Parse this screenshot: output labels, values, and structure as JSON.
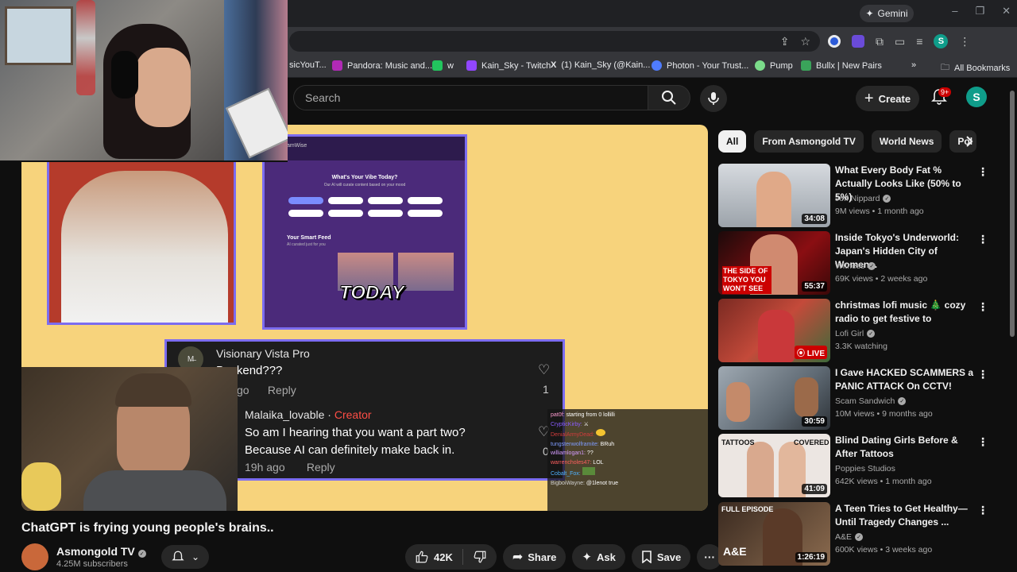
{
  "browser": {
    "gemini_label": "Gemini",
    "window_controls": [
      "–",
      "❐",
      "✕"
    ],
    "profile_letter": "S",
    "bookmarks": [
      {
        "label": "sicYouT...",
        "color": "#cc0000"
      },
      {
        "label": "Pandora: Music and...",
        "color": "#b02ab5"
      },
      {
        "label": "w",
        "color": "#22c55e"
      },
      {
        "label": "Kain_Sky - Twitch",
        "color": "#9146ff"
      },
      {
        "label": "(1) Kain_Sky (@Kain...",
        "color": "#000000"
      },
      {
        "label": "Photon - Your Trust...",
        "color": "#4f7cff"
      },
      {
        "label": "Pump",
        "color": "#7bdc8a"
      },
      {
        "label": "Bullx | New Pairs",
        "color": "#3aa35a"
      }
    ],
    "all_bookmarks": "All Bookmarks",
    "more_bookmarks": "»"
  },
  "header": {
    "search_placeholder": "Search",
    "create_label": "Create",
    "notif_badge": "9+",
    "avatar_letter": "S"
  },
  "video": {
    "overlay_text": "TODAY",
    "app_header": "amWise",
    "app_heading": "What's Your Vibe Today?",
    "app_sub": "Our AI will curate content based on your mood",
    "feed_title": "Your Smart Feed",
    "feed_sub": "AI curated just for you",
    "comment1": {
      "avatar": "M̶",
      "name": "Visionary Vista Pro",
      "text": "Backend???",
      "time": "go",
      "reply": "Reply",
      "likes": "1"
    },
    "comment2": {
      "name": "Malaika_lovable",
      "creator_tag": "Creator",
      "line1": "So am I hearing that you want a part two?",
      "line2": "Because AI can definitely make back in.",
      "time": "19h ago",
      "reply": "Reply",
      "likes": "0"
    },
    "chat": [
      {
        "user": "pat0f:",
        "msg": "starting from 0 lollilli",
        "color": "#ff9bd1"
      },
      {
        "user": "CrypticKirby:",
        "msg": "",
        "color": "#8a5cff"
      },
      {
        "user": "DenialArmyDead:",
        "msg": "",
        "color": "#d23c3c"
      },
      {
        "user": "tungstenwolframite:",
        "msg": "BRuh",
        "color": "#7f9cff"
      },
      {
        "user": "williamlogan1:",
        "msg": "??",
        "color": "#d49cff"
      },
      {
        "user": "warrencholes47:",
        "msg": "LOL",
        "color": "#ff5f5f"
      },
      {
        "user": "Cobalt_Fox:",
        "msg": "",
        "color": "#4fb3ff"
      },
      {
        "user": "BigboiWayne:",
        "msg": "@1lenot true",
        "color": "#cfcfcf"
      }
    ]
  },
  "below": {
    "title": "ChatGPT is frying young people's brains..",
    "channel_name": "Asmongold TV",
    "channel_subs": "4.25M subscribers",
    "like_count": "42K",
    "share_label": "Share",
    "ask_label": "Ask",
    "save_label": "Save"
  },
  "chips": [
    "All",
    "From Asmongold TV",
    "World News",
    "Pol"
  ],
  "recommendations": [
    {
      "title": "What Every Body Fat % Actually Looks Like (50% to 5%)",
      "channel": "Jeff Nippard",
      "verified": true,
      "meta": "9M views • 1 month ago",
      "duration": "34:08",
      "live": false,
      "thumb_color": "#b4b9be"
    },
    {
      "title": "Inside Tokyo's Underworld: Japan's Hidden City of Women...",
      "channel": "Witness",
      "verified": true,
      "meta": "69K views • 2 weeks ago",
      "duration": "55:37",
      "live": false,
      "thumb_color": "#7a1010",
      "thumb_text": "THE SIDE OF TOKYO YOU WON'T SEE"
    },
    {
      "title": "christmas lofi music 🎄 cozy radio to get festive to",
      "channel": "Lofi Girl",
      "verified": true,
      "meta": "3.3K watching",
      "duration": "LIVE",
      "live": true,
      "thumb_color": "#a83a2f"
    },
    {
      "title": "I Gave HACKED SCAMMERS a PANIC ATTACK On CCTV!",
      "channel": "Scam Sandwich",
      "verified": true,
      "meta": "10M views • 9 months ago",
      "duration": "30:59",
      "live": false,
      "thumb_color": "#6b7b88"
    },
    {
      "title": "Blind Dating Girls Before & After Tattoos",
      "channel": "Poppies Studios",
      "verified": false,
      "meta": "642K views • 1 month ago",
      "duration": "41:09",
      "live": false,
      "thumb_color": "#e9e0dc",
      "thumb_text_left": "TATTOOS",
      "thumb_text_right": "COVERED"
    },
    {
      "title": "A Teen Tries to Get Healthy— Until Tragedy Changes ...",
      "channel": "A&E",
      "verified": true,
      "meta": "600K views • 3 weeks ago",
      "duration": "1:26:19",
      "live": false,
      "thumb_color": "#6b4a36",
      "thumb_text": "FULL EPISODE",
      "thumb_logo": "A&E"
    }
  ]
}
